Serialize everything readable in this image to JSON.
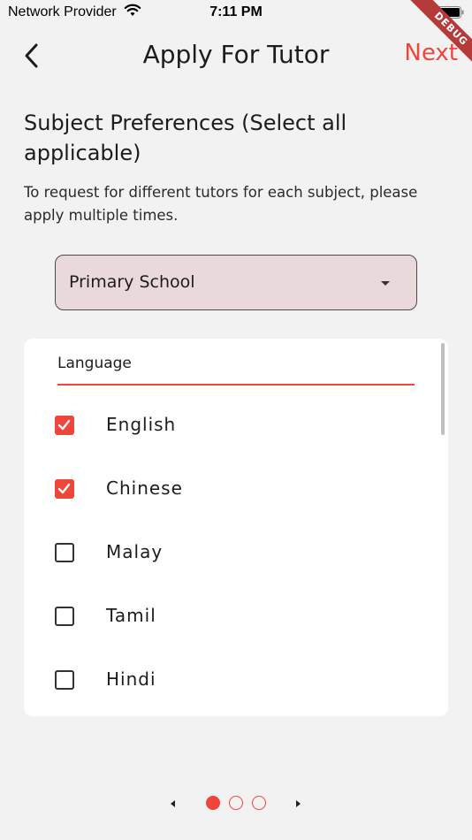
{
  "status_bar": {
    "carrier": "Network Provider",
    "time": "7:11 PM",
    "wifi_icon": "wifi-icon",
    "battery_icon": "battery-icon"
  },
  "debug_banner": "DEBUG",
  "app_bar": {
    "back_icon": "chevron-left-icon",
    "title": "Apply For Tutor",
    "next_label": "Next"
  },
  "form": {
    "section_title": "Subject Preferences (Select all applicable)",
    "helper_text": "To request for different tutors for each subject, please apply multiple times.",
    "level_dropdown": {
      "value": "Primary School",
      "caret_icon": "caret-down-icon"
    },
    "subject_card": {
      "category": "Language",
      "subjects": [
        {
          "label": "English",
          "checked": true
        },
        {
          "label": "Chinese",
          "checked": true
        },
        {
          "label": "Malay",
          "checked": false
        },
        {
          "label": "Tamil",
          "checked": false
        },
        {
          "label": "Hindi",
          "checked": false
        }
      ]
    }
  },
  "pager": {
    "total_pages": 3,
    "current_page": 1,
    "prev_icon": "caret-left-icon",
    "next_icon": "caret-right-icon"
  },
  "colors": {
    "accent": "#f0453a",
    "background": "#f2f2f2",
    "dropdown_fill": "#ead9db"
  }
}
